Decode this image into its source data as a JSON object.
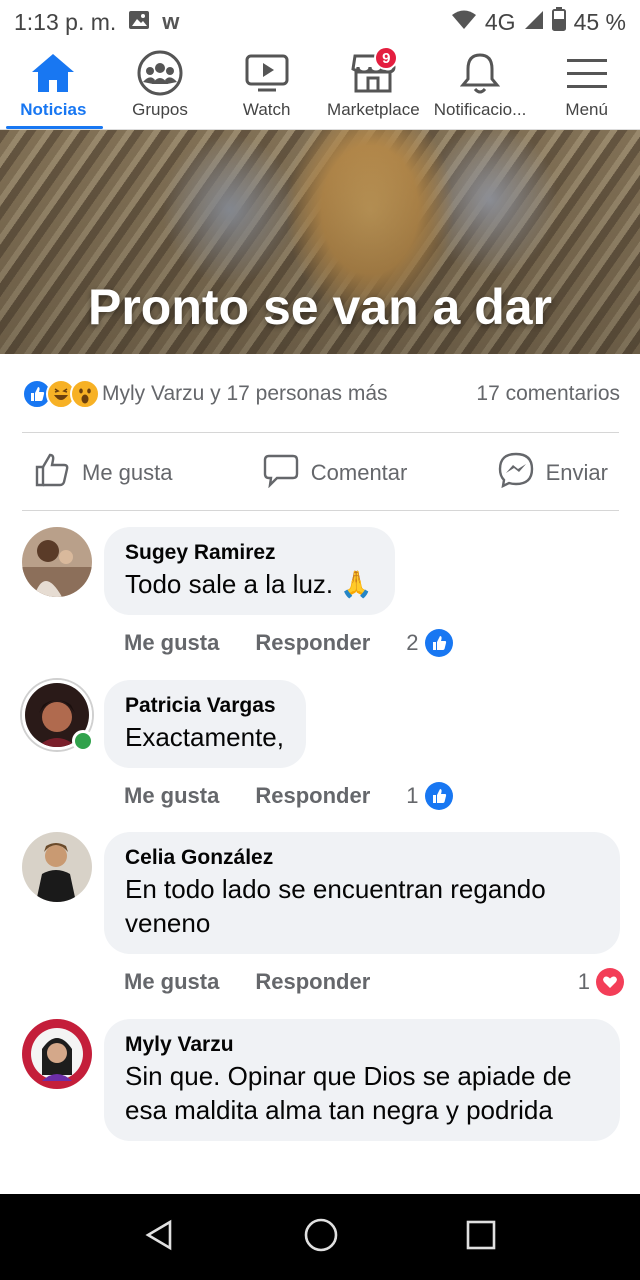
{
  "status_bar": {
    "time": "1:13 p. m.",
    "network": "4G",
    "battery": "45 %",
    "app_glyph": "w"
  },
  "nav": {
    "items": [
      {
        "label": "Noticias",
        "icon": "home-icon",
        "active": true
      },
      {
        "label": "Grupos",
        "icon": "groups-icon"
      },
      {
        "label": "Watch",
        "icon": "watch-icon"
      },
      {
        "label": "Marketplace",
        "icon": "marketplace-icon",
        "badge": "9"
      },
      {
        "label": "Notificacio...",
        "icon": "bell-icon"
      },
      {
        "label": "Menú",
        "icon": "hamburger-icon"
      }
    ]
  },
  "post": {
    "image_caption": "Pronto se van a dar",
    "reactions_text": "Myly Varzu y 17 personas más",
    "comments_count": "17 comentarios",
    "actions": {
      "like": "Me gusta",
      "comment": "Comentar",
      "send": "Enviar"
    }
  },
  "comments": [
    {
      "author": "Sugey Ramirez",
      "text": "Todo sale a la luz. 🙏",
      "like_label": "Me gusta",
      "reply_label": "Responder",
      "reaction_count": "2",
      "reaction": "like"
    },
    {
      "author": "Patricia Vargas",
      "text": "Exactamente,",
      "like_label": "Me gusta",
      "reply_label": "Responder",
      "reaction_count": "1",
      "reaction": "like",
      "online": true
    },
    {
      "author": "Celia González",
      "text": "En todo lado se encuentran regando veneno",
      "like_label": "Me gusta",
      "reply_label": "Responder",
      "reaction_count": "1",
      "reaction": "love"
    },
    {
      "author": "Myly Varzu",
      "text": "Sin que. Opinar que Dios se apiade de esa maldita alma tan negra y podrida"
    }
  ],
  "colors": {
    "accent": "#1877f2",
    "bubble": "#f0f2f5",
    "love": "#f33e58",
    "online": "#31a24c"
  }
}
